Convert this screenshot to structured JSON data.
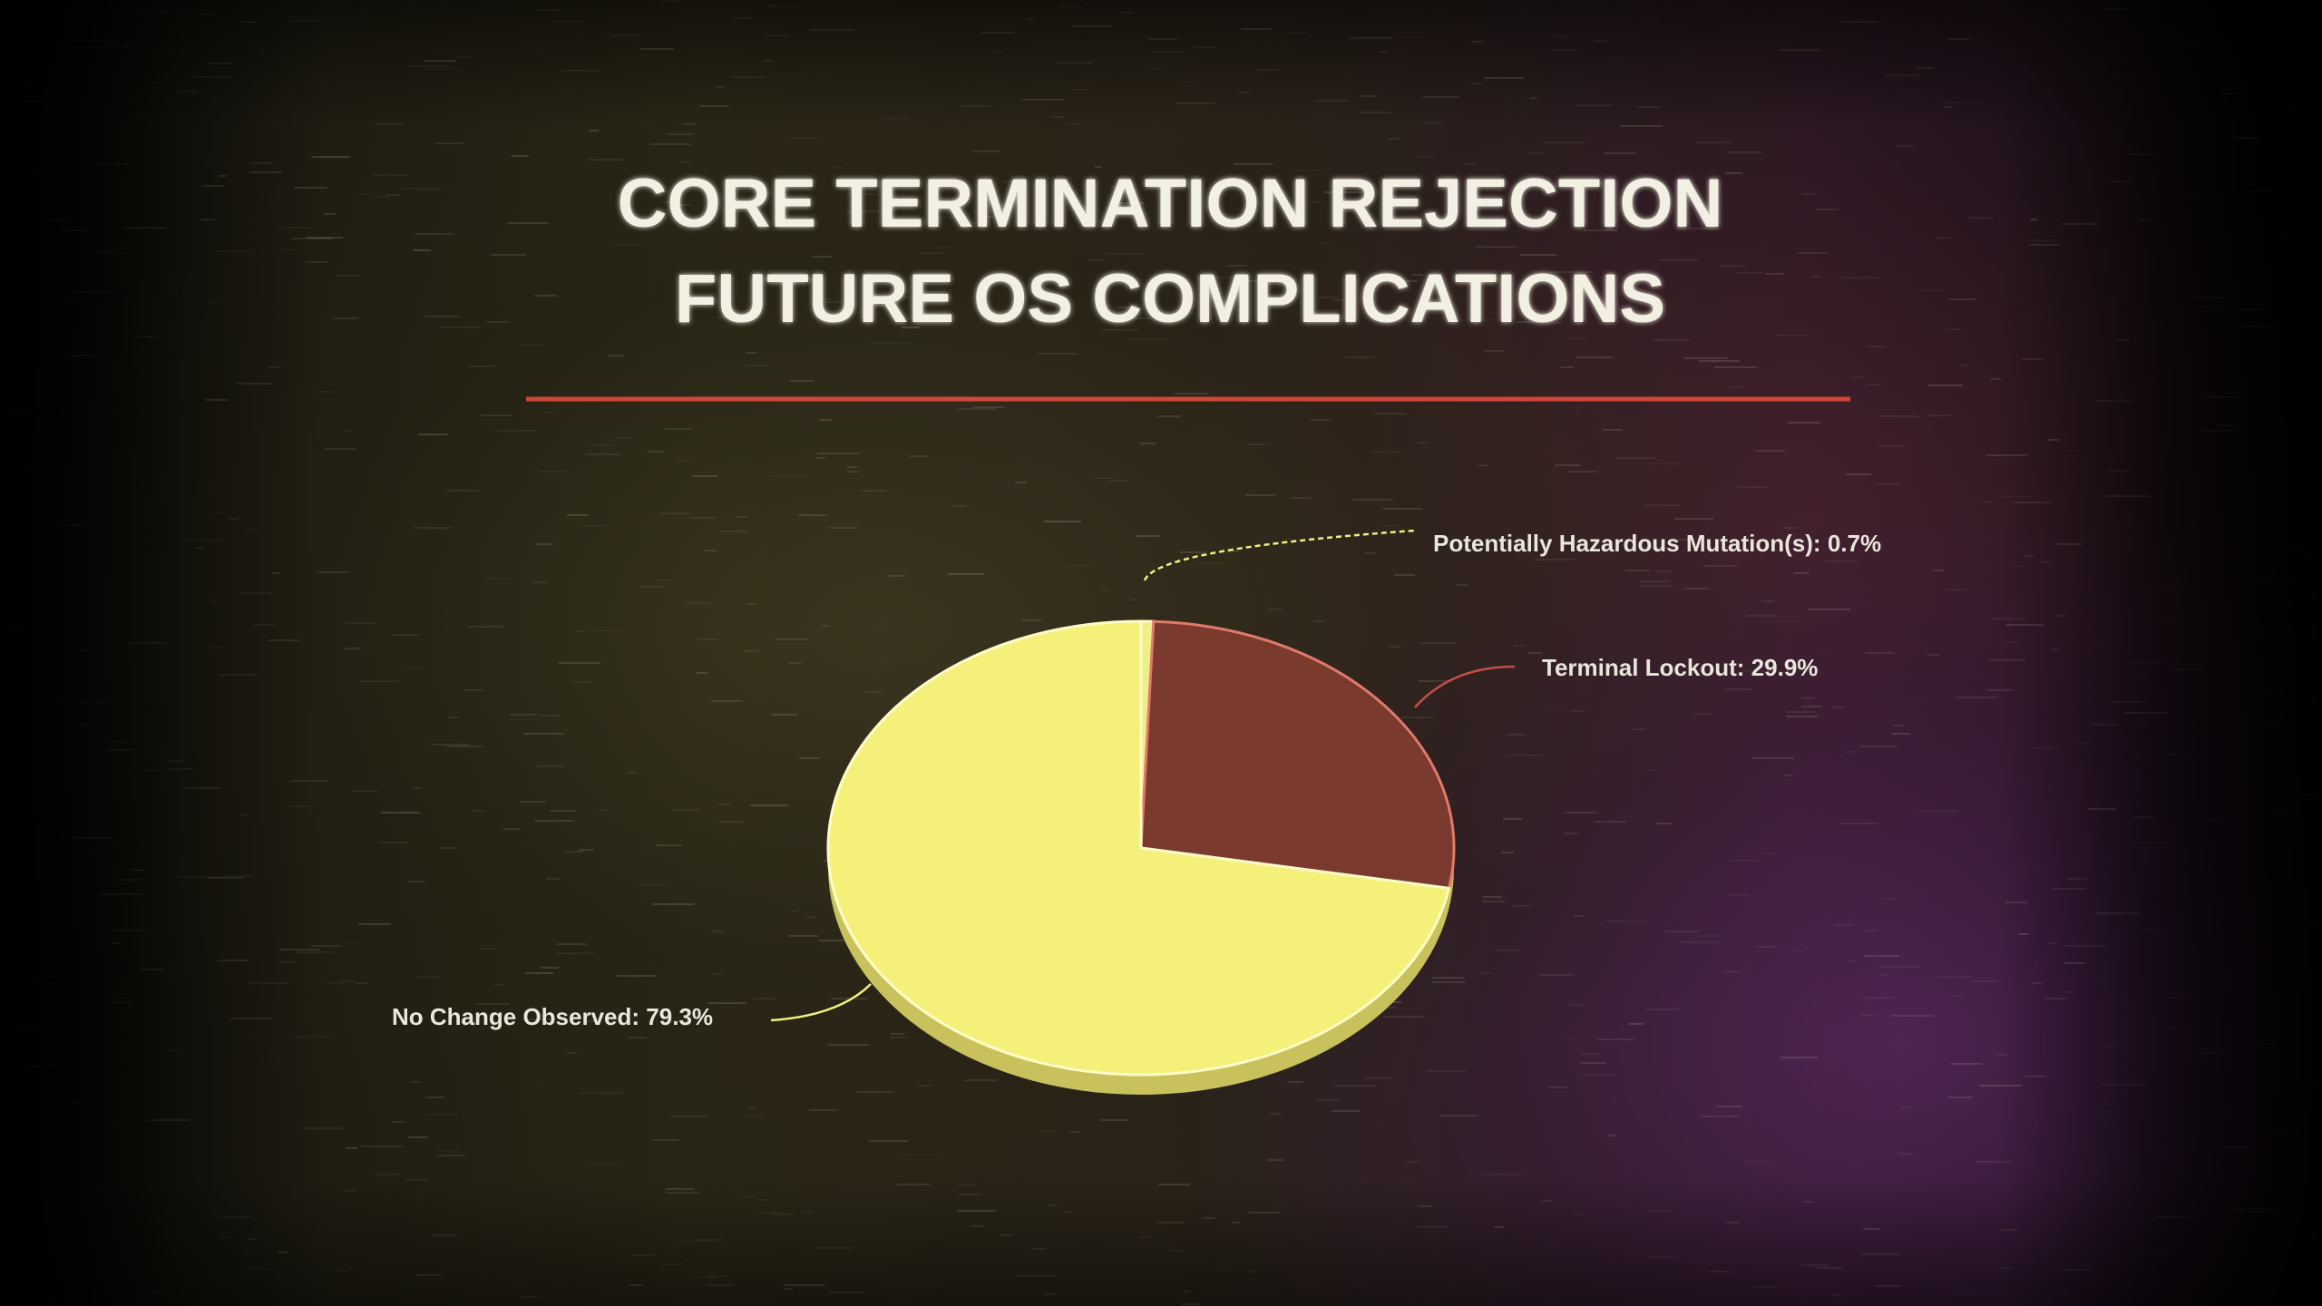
{
  "chart_data": {
    "type": "pie",
    "title_lines": [
      "CORE TERMINATION REJECTION",
      "FUTURE OS COMPLICATIONS"
    ],
    "slices": [
      {
        "label": "Potentially Hazardous Mutation(s)",
        "value": 0.7,
        "value_text": "0.7%",
        "color": "#f0ee86"
      },
      {
        "label": "Terminal Lockout",
        "value": 29.9,
        "value_text": "29.9%",
        "color": "#7a3a2e"
      },
      {
        "label": "No Change Observed",
        "value": 79.3,
        "value_text": "79.3%",
        "color": "#f4f07a"
      }
    ],
    "legend": "none",
    "divider_color": "#d0463a",
    "text_color": "#f2efe3"
  }
}
